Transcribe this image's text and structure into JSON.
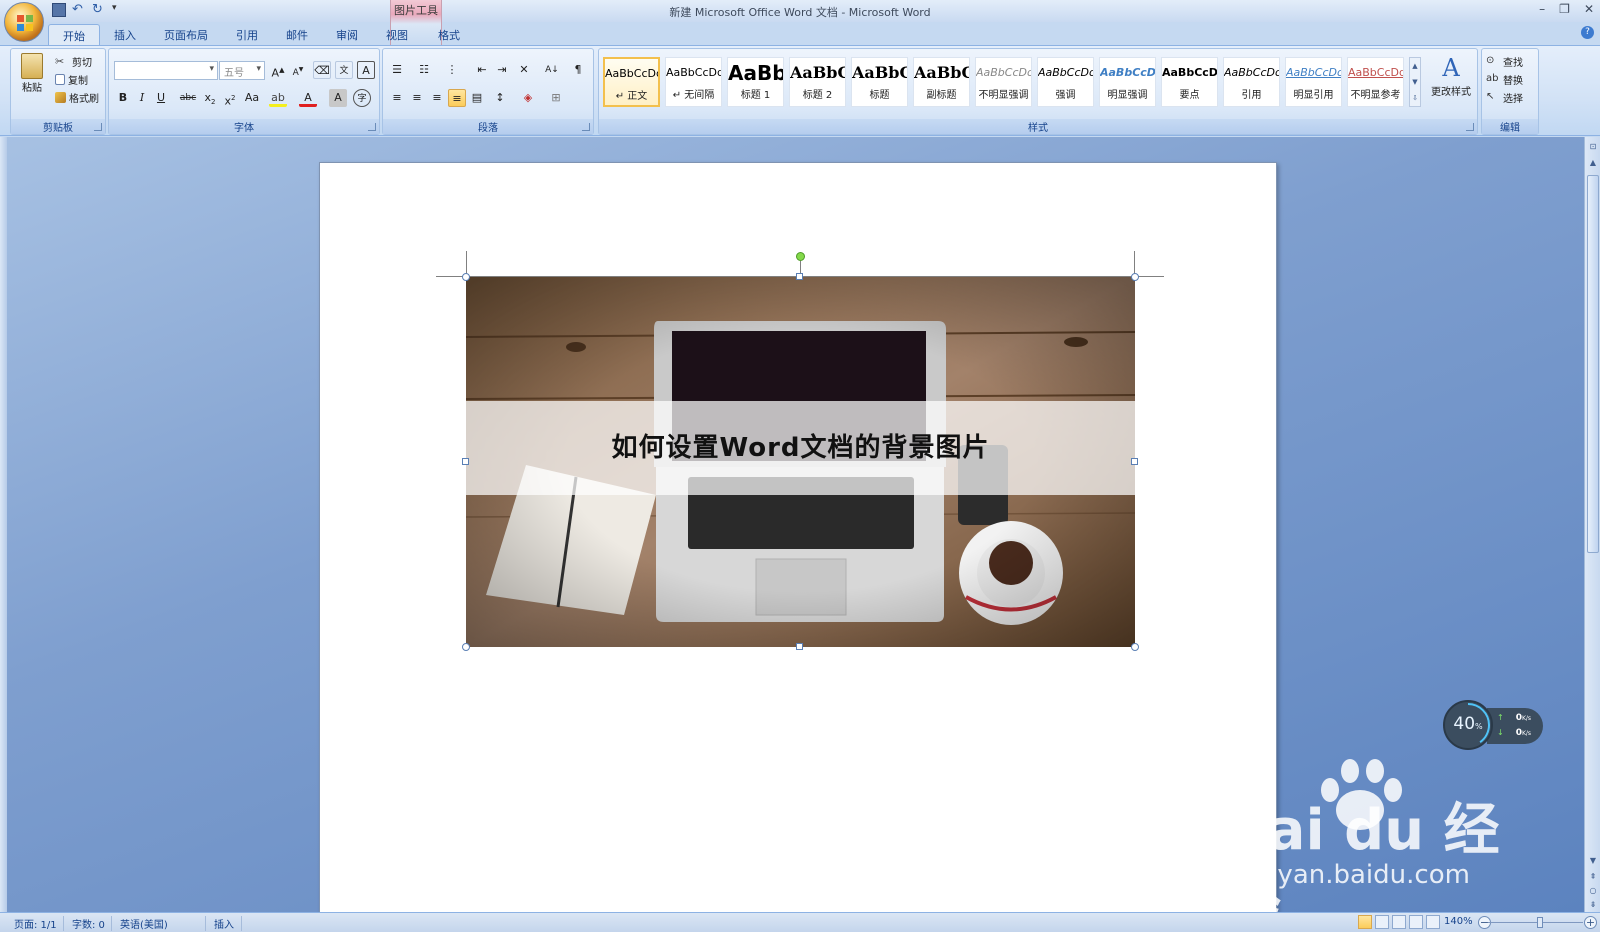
{
  "window": {
    "title": "新建 Microsoft Office Word 文档 - Microsoft Word",
    "context_tool": "图片工具"
  },
  "tabs": [
    "开始",
    "插入",
    "页面布局",
    "引用",
    "邮件",
    "审阅",
    "视图",
    "格式"
  ],
  "ribbon": {
    "clipboard": {
      "label": "剪贴板",
      "paste": "粘贴",
      "cut": "剪切",
      "copy": "复制",
      "format_painter": "格式刷"
    },
    "font": {
      "label": "字体",
      "font_name": "",
      "font_size": "五号"
    },
    "paragraph": {
      "label": "段落"
    },
    "styles": {
      "label": "样式",
      "tiles": [
        {
          "sample": "AaBbCcDd",
          "name": "↵ 正文"
        },
        {
          "sample": "AaBbCcDd",
          "name": "↵ 无间隔"
        },
        {
          "sample": "AaBb",
          "name": "标题 1"
        },
        {
          "sample": "AaBbC",
          "name": "标题 2"
        },
        {
          "sample": "AaBbC",
          "name": "标题"
        },
        {
          "sample": "AaBbC",
          "name": "副标题"
        },
        {
          "sample": "AaBbCcDd",
          "name": "不明显强调"
        },
        {
          "sample": "AaBbCcDd",
          "name": "强调"
        },
        {
          "sample": "AaBbCcDd",
          "name": "明显强调"
        },
        {
          "sample": "AaBbCcDd",
          "name": "要点"
        },
        {
          "sample": "AaBbCcDd",
          "name": "引用"
        },
        {
          "sample": "AaBbCcDd",
          "name": "明显引用"
        },
        {
          "sample": "AaBbCcDd",
          "name": "不明显参考"
        }
      ],
      "change_styles": "更改样式"
    },
    "editing": {
      "label": "编辑",
      "find": "查找",
      "replace": "替换",
      "select": "选择"
    }
  },
  "document": {
    "image_caption": "如何设置Word文档的背景图片"
  },
  "network_widget": {
    "percent": "40",
    "percent_unit": "%",
    "up": "0",
    "down": "0",
    "unit": "K/s"
  },
  "watermark": {
    "brand": "Bai du 经验",
    "url": "jingyan.baidu.com"
  },
  "statusbar": {
    "page": "页面: 1/1",
    "words": "字数: 0",
    "language": "英语(美国)",
    "mode": "插入",
    "zoom": "140%"
  },
  "colors": {
    "accent": "#15428b",
    "ribbon_bg": "#dbe8f8",
    "workspace": "#6f92c8"
  }
}
